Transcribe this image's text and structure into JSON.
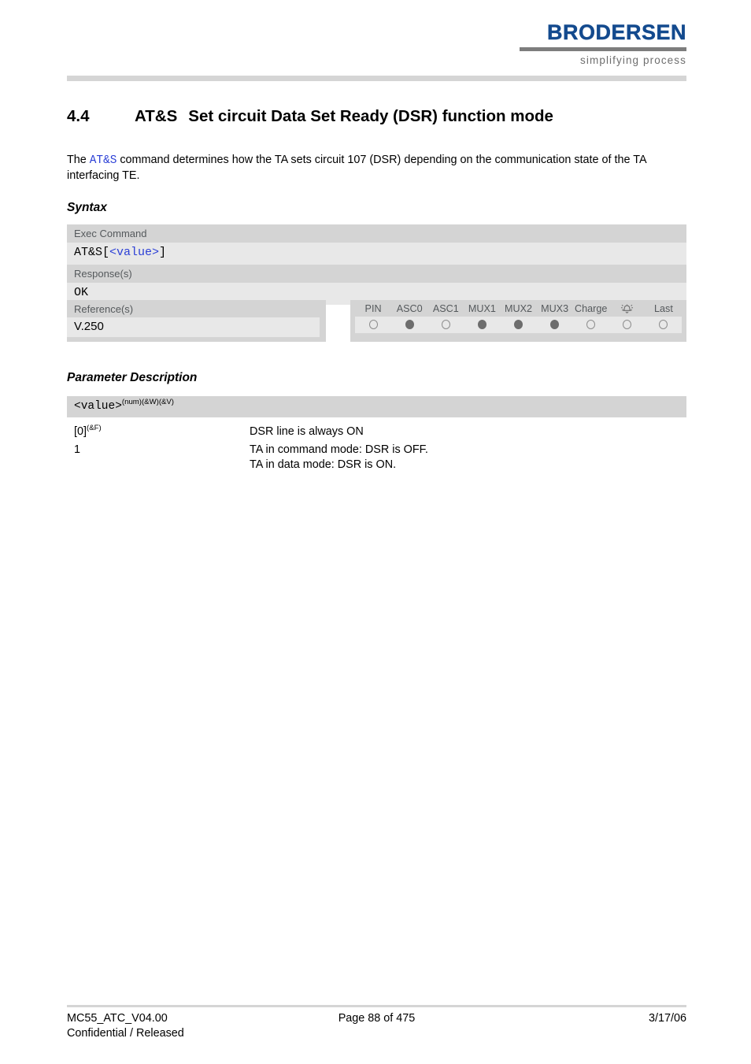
{
  "header": {
    "logo_text": "BRODERSEN",
    "logo_tagline": "simplifying process",
    "logo_color": "#134a8e",
    "rule_color": "#d5d5d5"
  },
  "section": {
    "number": "4.4",
    "command": "AT&S",
    "title": "Set circuit Data Set Ready (DSR) function mode"
  },
  "intro": {
    "part1": "The ",
    "command": "AT&S",
    "part2": " command determines how the TA sets circuit 107 (DSR) depending on the communication state of the TA interfacing TE."
  },
  "syntax": {
    "heading": "Syntax",
    "exec_label": "Exec Command",
    "exec_prefix": "AT&S[",
    "exec_value": "<value>",
    "exec_suffix": "]",
    "response_label": "Response(s)",
    "response_value": "OK",
    "reference_label": "Reference(s)",
    "reference_value": "V.250",
    "support_columns": [
      {
        "label": "PIN",
        "icon": "",
        "state": "empty"
      },
      {
        "label": "ASC0",
        "icon": "",
        "state": "filled"
      },
      {
        "label": "ASC1",
        "icon": "",
        "state": "empty"
      },
      {
        "label": "MUX1",
        "icon": "",
        "state": "filled"
      },
      {
        "label": "MUX2",
        "icon": "",
        "state": "filled"
      },
      {
        "label": "MUX3",
        "icon": "",
        "state": "filled"
      },
      {
        "label": "Charge",
        "icon": "",
        "state": "empty"
      },
      {
        "label": "",
        "icon": "alarm-bell-icon",
        "state": "empty"
      },
      {
        "label": "Last",
        "icon": "",
        "state": "empty"
      }
    ]
  },
  "parameter_description": {
    "heading": "Parameter Description",
    "param_name": "<value>",
    "param_sup": "(num)(&W)(&V)",
    "rows": [
      {
        "key": "[0]",
        "key_sup": "(&F)",
        "desc": [
          "DSR line is always ON"
        ]
      },
      {
        "key": "1",
        "key_sup": "",
        "desc": [
          "TA in command mode: DSR is OFF.",
          "TA in data mode: DSR is ON."
        ]
      }
    ]
  },
  "footer": {
    "doc_id": "MC55_ATC_V04.00",
    "page": "Page 88 of 475",
    "date": "3/17/06",
    "classification": "Confidential / Released"
  }
}
